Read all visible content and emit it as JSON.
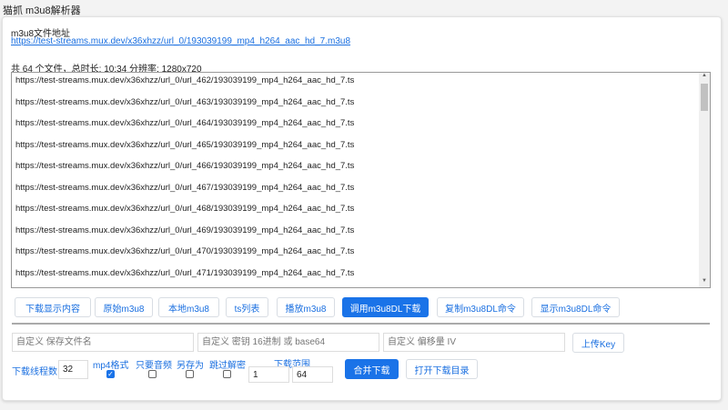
{
  "window_title": "猫抓 m3u8解析器",
  "url_label": "m3u8文件地址",
  "url": "https://test-streams.mux.dev/x36xhzz/url_0/193039199_mp4_h264_aac_hd_7.m3u8",
  "info": "共 64 个文件，总时长: 10:34 分辨率: 1280x720",
  "ts_lines": [
    "https://test-streams.mux.dev/x36xhzz/url_0/url_462/193039199_mp4_h264_aac_hd_7.ts",
    "https://test-streams.mux.dev/x36xhzz/url_0/url_463/193039199_mp4_h264_aac_hd_7.ts",
    "https://test-streams.mux.dev/x36xhzz/url_0/url_464/193039199_mp4_h264_aac_hd_7.ts",
    "https://test-streams.mux.dev/x36xhzz/url_0/url_465/193039199_mp4_h264_aac_hd_7.ts",
    "https://test-streams.mux.dev/x36xhzz/url_0/url_466/193039199_mp4_h264_aac_hd_7.ts",
    "https://test-streams.mux.dev/x36xhzz/url_0/url_467/193039199_mp4_h264_aac_hd_7.ts",
    "https://test-streams.mux.dev/x36xhzz/url_0/url_468/193039199_mp4_h264_aac_hd_7.ts",
    "https://test-streams.mux.dev/x36xhzz/url_0/url_469/193039199_mp4_h264_aac_hd_7.ts",
    "https://test-streams.mux.dev/x36xhzz/url_0/url_470/193039199_mp4_h264_aac_hd_7.ts",
    "https://test-streams.mux.dev/x36xhzz/url_0/url_471/193039199_mp4_h264_aac_hd_7.ts"
  ],
  "buttons": [
    "下载显示内容",
    "原始m3u8",
    "本地m3u8",
    "ts列表",
    "播放m3u8",
    "调用m3u8DL下载",
    "复制m3u8DL命令",
    "显示m3u8DL命令"
  ],
  "inputs": {
    "filename_placeholder": "自定义 保存文件名",
    "key_placeholder": "自定义 密钥 16进制 或 base64",
    "iv_placeholder": "自定义 偏移量 IV",
    "upload_key": "上传Key"
  },
  "threads": {
    "label": "下载线程数",
    "value": "32"
  },
  "options": [
    {
      "label": "mp4格式",
      "checked": true
    },
    {
      "label": "只要音频",
      "checked": false
    },
    {
      "label": "另存为",
      "checked": false
    },
    {
      "label": "跳过解密",
      "checked": false
    }
  ],
  "range": {
    "label": "下载范围",
    "start": "1",
    "end": "64"
  },
  "merge_download": "合并下载",
  "open_dir": "打开下载目录"
}
